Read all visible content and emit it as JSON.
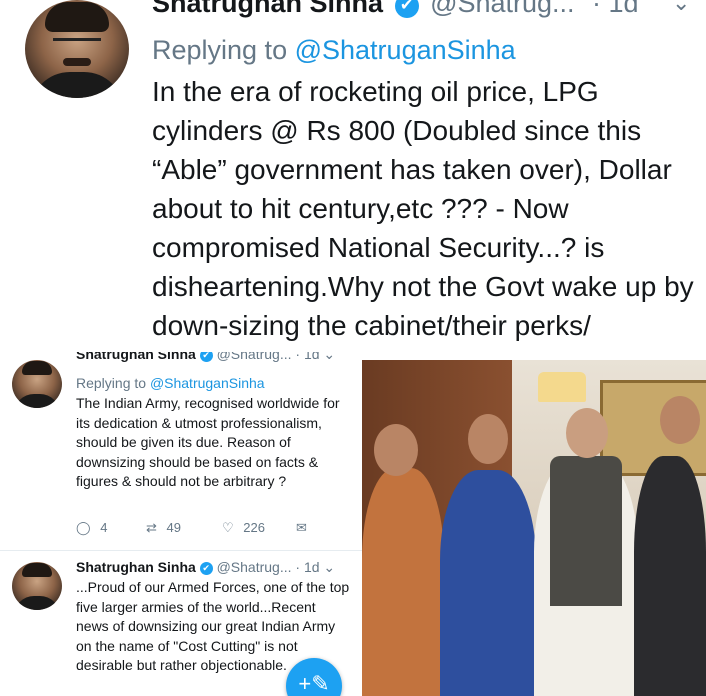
{
  "top_tweet": {
    "author_name": "Shatrughan Sinha",
    "handle": "@Shatrug...",
    "time": "· 1d",
    "replying_prefix": "Replying to",
    "replying_handle": "@ShatruganSinha",
    "text": "In the era of rocketing oil price, LPG cylinders @ Rs 800 (Doubled since this “Able” government has taken over), Dollar about to hit century,etc  ??? - Now compromised National Security...? is disheartening.Why not the Govt wake up by down-sizing the cabinet/their perks/"
  },
  "tweets": [
    {
      "author_name": "Shatrughan Sinha",
      "handle": "@Shatrug...",
      "time": "· 1d",
      "replying_prefix": "Replying to",
      "replying_handle": "@ShatruganSinha",
      "text": "The Indian Army, recognised worldwide for its dedication & utmost professionalism, should be given its due. Reason of downsizing should be based on facts & figures & should not be arbitrary ?",
      "replies": "4",
      "retweets": "49",
      "likes": "226"
    },
    {
      "author_name": "Shatrughan Sinha",
      "handle": "@Shatrug...",
      "time": "· 1d",
      "text": "...Proud of our Armed Forces, one of the top five larger armies of the world...Recent news of downsizing our great Indian Army on the name of \"Cost Cutting\" is not desirable but rather objectionable."
    }
  ],
  "icons": {
    "verified": "✔",
    "chevron": "⌄",
    "reply": "◯",
    "retweet": "⇄",
    "like": "♡",
    "message": "✉",
    "compose": "+✎"
  },
  "colors": {
    "accent": "#1b95e0",
    "muted": "#657786",
    "text": "#14171a"
  }
}
